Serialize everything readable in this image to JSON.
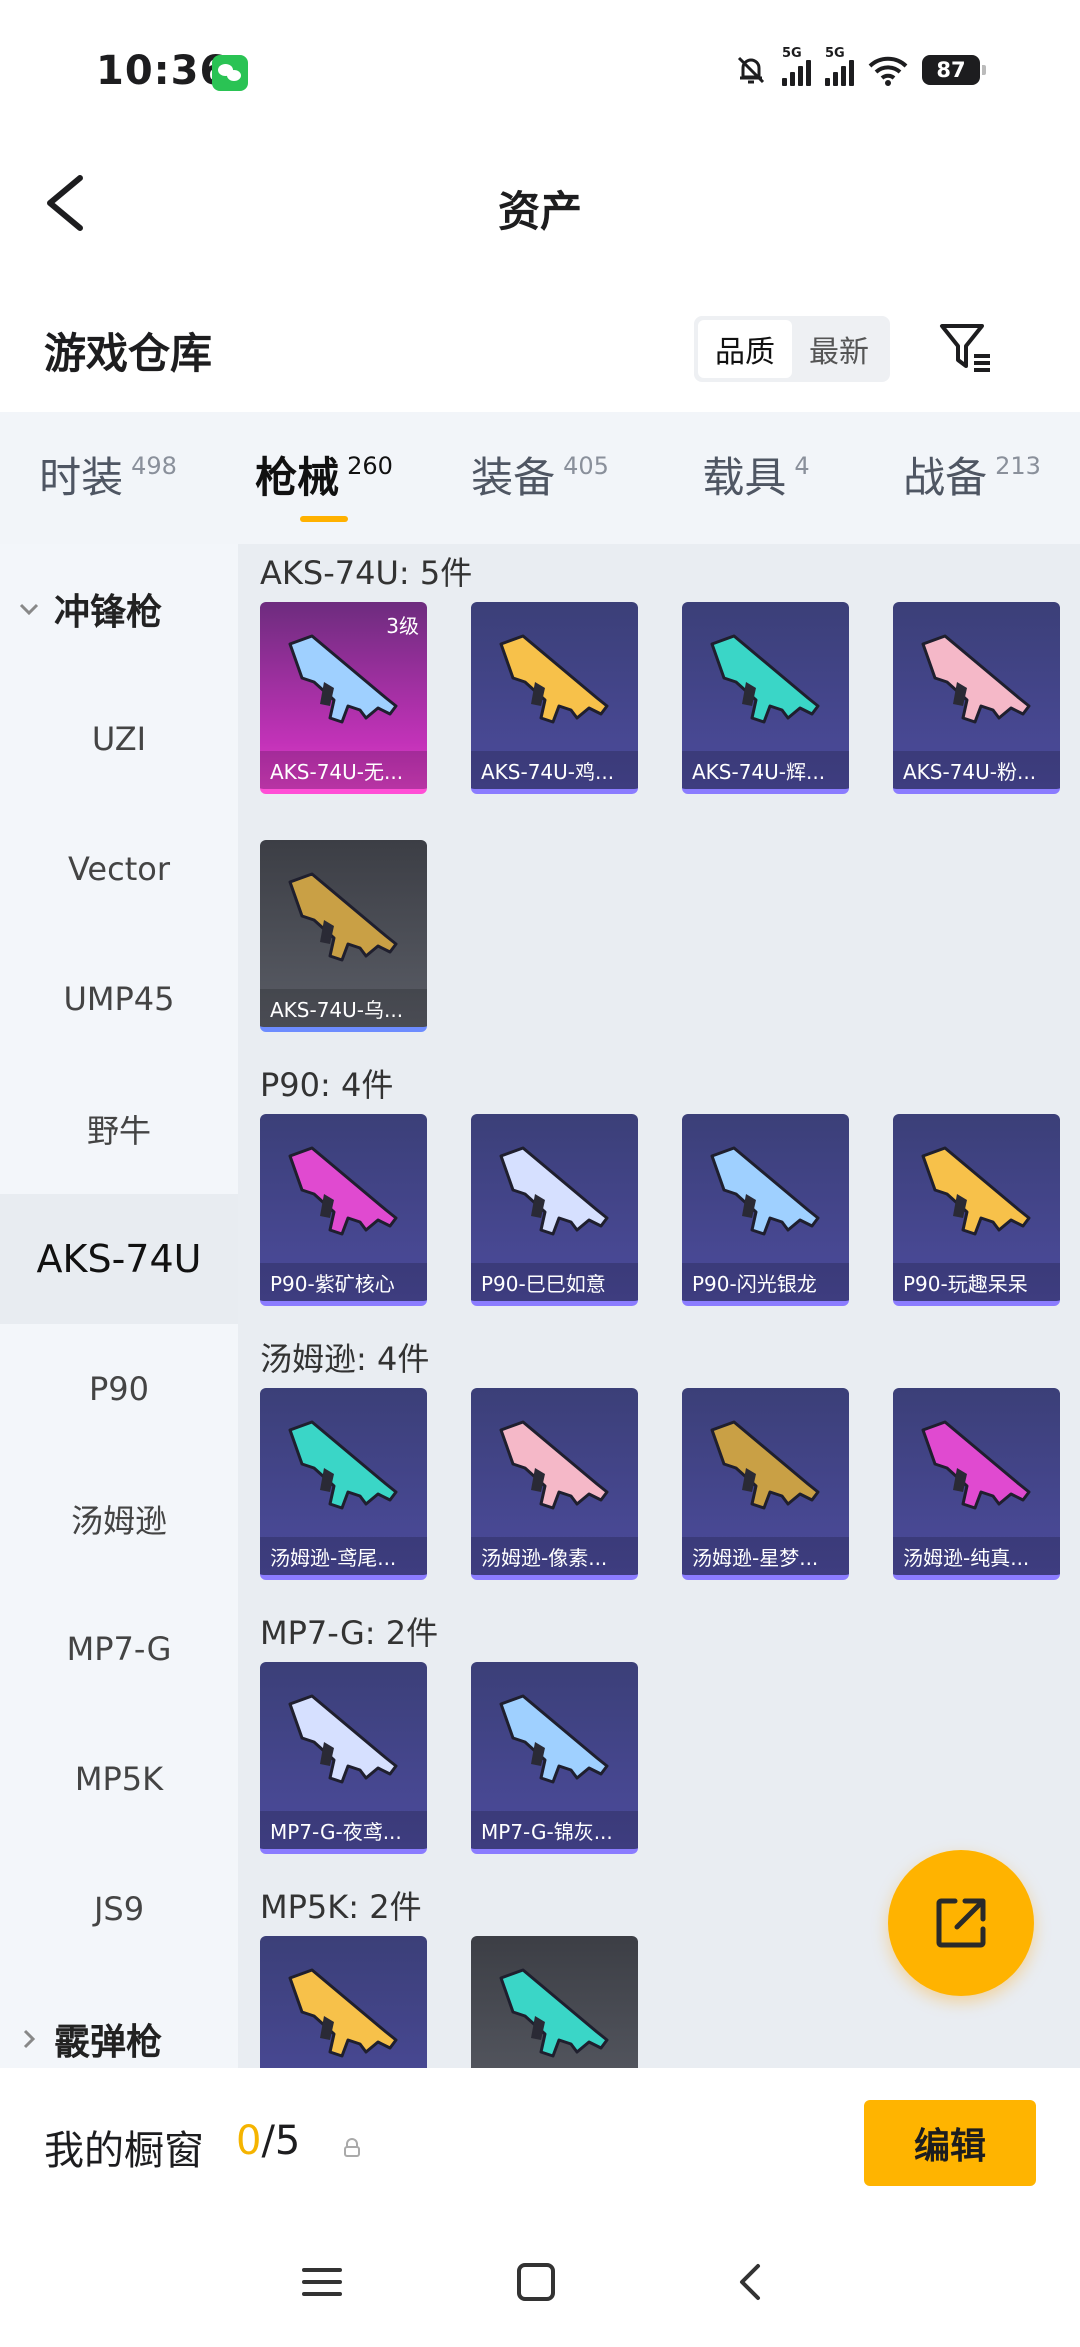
{
  "status_bar": {
    "time": "10:36",
    "battery": "87",
    "network_tag": "5G"
  },
  "header": {
    "title": "资产"
  },
  "warehouse": {
    "title": "游戏仓库",
    "sort_options": [
      "品质",
      "最新"
    ],
    "active_sort": "品质"
  },
  "tabs": [
    {
      "label": "时装",
      "count": "498"
    },
    {
      "label": "枪械",
      "count": "260",
      "active": true
    },
    {
      "label": "装备",
      "count": "405"
    },
    {
      "label": "载具",
      "count": "4"
    },
    {
      "label": "战备",
      "count": "213"
    }
  ],
  "sidebar": {
    "category_open": "冲锋枪",
    "items": [
      "UZI",
      "Vector",
      "UMP45",
      "野牛",
      "AKS-74U",
      "P90",
      "汤姆逊",
      "MP7-G",
      "MP5K",
      "JS9"
    ],
    "active": "AKS-74U",
    "category_closed": "霰弹枪"
  },
  "groups": [
    {
      "title": "AKS-74U: 5件",
      "items": [
        {
          "name": "AKS-74U-无...",
          "level": "3级",
          "rarity": "legend"
        },
        {
          "name": "AKS-74U-鸡...",
          "rarity": "epic"
        },
        {
          "name": "AKS-74U-辉...",
          "rarity": "epic"
        },
        {
          "name": "AKS-74U-粉...",
          "rarity": "epic"
        },
        {
          "name": "AKS-74U-乌...",
          "rarity": "grey"
        }
      ]
    },
    {
      "title": "P90: 4件",
      "items": [
        {
          "name": "P90-紫矿核心",
          "rarity": "epic"
        },
        {
          "name": "P90-巳巳如意",
          "rarity": "epic"
        },
        {
          "name": "P90-闪光银龙",
          "rarity": "epic"
        },
        {
          "name": "P90-玩趣呆呆",
          "rarity": "epic"
        }
      ]
    },
    {
      "title": "汤姆逊: 4件",
      "items": [
        {
          "name": "汤姆逊-鸢尾...",
          "rarity": "epic"
        },
        {
          "name": "汤姆逊-像素...",
          "rarity": "epic"
        },
        {
          "name": "汤姆逊-星梦...",
          "rarity": "epic"
        },
        {
          "name": "汤姆逊-纯真...",
          "rarity": "epic"
        }
      ]
    },
    {
      "title": "MP7-G: 2件",
      "items": [
        {
          "name": "MP7-G-夜鸢...",
          "rarity": "epic"
        },
        {
          "name": "MP7-G-锦灰...",
          "rarity": "epic"
        }
      ]
    },
    {
      "title": "MP5K: 2件",
      "items": [
        {
          "name": "",
          "rarity": "epic"
        },
        {
          "name": "",
          "rarity": "grey"
        }
      ]
    }
  ],
  "showcase": {
    "title": "我的橱窗",
    "current": "0",
    "total": "/5",
    "edit_label": "编辑"
  },
  "icons": {
    "back": "chevron-left-icon",
    "filter": "filter-icon",
    "fab": "share-external-icon",
    "nav": [
      "menu-icon",
      "home-square-icon",
      "back-triangle-icon"
    ]
  },
  "colors": {
    "accent": "#ffb400",
    "legend": "#c232b8",
    "epic": "#4c4b9c"
  }
}
